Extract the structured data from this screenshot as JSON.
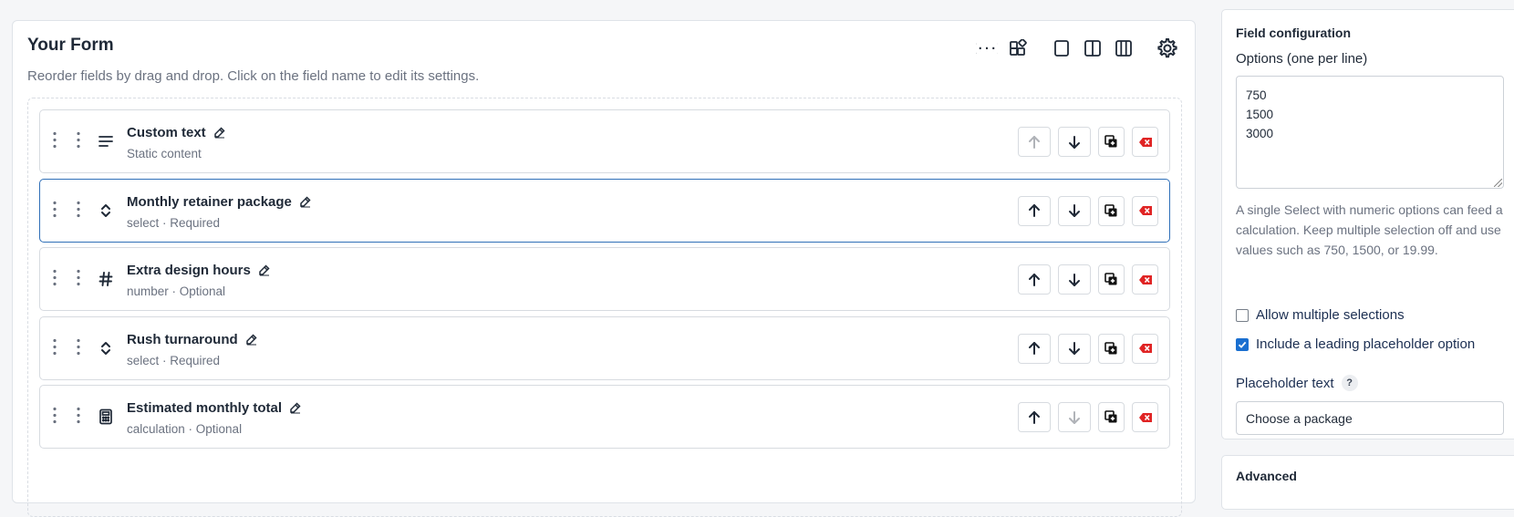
{
  "form": {
    "title": "Your Form",
    "subtitle": "Reorder fields by drag and drop. Click on the field name to edit its settings.",
    "toolbar_icons": [
      "code-braces-icon",
      "blocks-icon",
      "single-column-icon",
      "two-column-icon",
      "three-column-icon",
      "gear-icon"
    ]
  },
  "fields": [
    {
      "name": "Custom text",
      "meta": "Static content",
      "icon": "text-lines-icon",
      "selected": false,
      "up_disabled": true,
      "down_disabled": false
    },
    {
      "name": "Monthly retainer package",
      "meta": "select · Required",
      "icon": "select-chevrons-icon",
      "selected": true,
      "up_disabled": false,
      "down_disabled": false
    },
    {
      "name": "Extra design hours",
      "meta": "number · Optional",
      "icon": "hash-icon",
      "selected": false,
      "up_disabled": false,
      "down_disabled": false
    },
    {
      "name": "Rush turnaround",
      "meta": "select · Required",
      "icon": "select-chevrons-icon",
      "selected": false,
      "up_disabled": false,
      "down_disabled": false
    },
    {
      "name": "Estimated monthly total",
      "meta": "calculation · Optional",
      "icon": "calculator-icon",
      "selected": false,
      "up_disabled": false,
      "down_disabled": true
    }
  ],
  "config": {
    "heading": "Field configuration",
    "options_label": "Options (one per line)",
    "options_value": "750\n1500\n3000",
    "help": "A single Select with numeric options can feed a calculation. Keep multiple selection off and use values such as 750, 1500, or 19.99.",
    "allow_multiple_label": "Allow multiple selections",
    "allow_multiple": false,
    "placeholder_option_label": "Include a leading placeholder option",
    "placeholder_option": true,
    "placeholder_text_label": "Placeholder text",
    "help_badge": "?",
    "placeholder_text_value": "Choose a package"
  },
  "advanced": {
    "heading": "Advanced"
  },
  "colors": {
    "accent": "#1a6fd0",
    "selected_border": "#2f6fb8",
    "delete": "#e02424"
  }
}
